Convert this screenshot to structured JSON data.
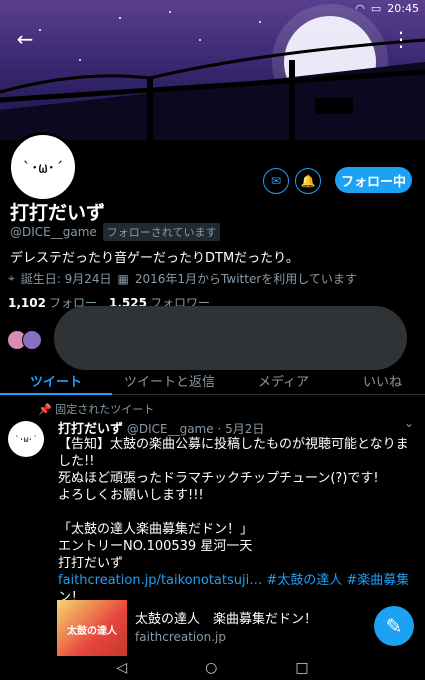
{
  "status_bar": {
    "time": "20:45"
  },
  "profile": {
    "avatar_text": "`･ω･´",
    "name": "打打だいず",
    "handle": "@DICE__game",
    "follows_you": "フォローされています",
    "bio": "デレステだったり音ゲーだったりDTMだったり。",
    "birthday": "誕生日: 9月24日",
    "joined": "2016年1月からTwitterを利用しています",
    "following_count": "1,102",
    "following_label": "フォロー",
    "followers_count": "1,525",
    "followers_label": "フォロワー",
    "follow_button": "フォロー中"
  },
  "tabs": [
    "ツイート",
    "ツイートと返信",
    "メディア",
    "いいね"
  ],
  "tweet": {
    "pinned_label": "固定されたツイート",
    "author": "打打だいず",
    "meta": "@DICE__game · 5月2日",
    "lines": [
      "【告知】太鼓の楽曲公募に投稿したものが視聴可能となりま",
      "した!!",
      "死ぬほど頑張ったドラマチックチップチューン(?)です!",
      "よろしくお願いします!!!",
      "",
      "「太鼓の達人楽曲募集だドン！」",
      "エントリーNO.100539 星河一天",
      "打打だいず"
    ],
    "link_line": "faithcreation.jp/taikonotatsuji… #太鼓の達人 #楽曲募集だド",
    "last_line": "ン！",
    "card_image_text": "太鼓の達人",
    "card_title": "太鼓の達人　楽曲募集だドン！",
    "card_domain": "faithcreation.jp"
  },
  "colors": {
    "accent": "#1da1f2",
    "background": "#000000",
    "muted": "#8899a6"
  }
}
